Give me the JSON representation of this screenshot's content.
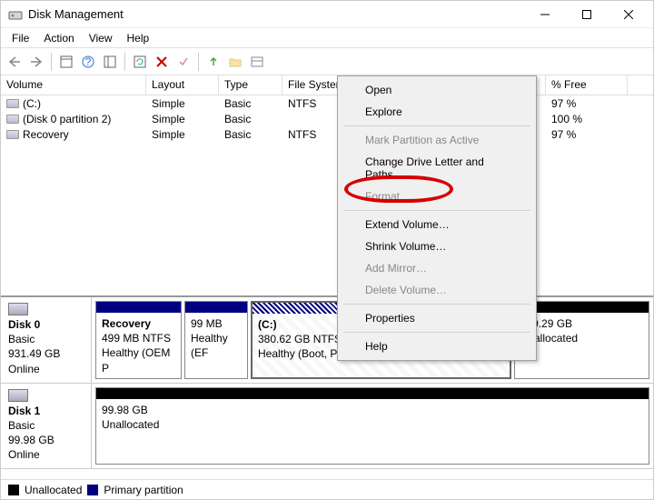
{
  "window": {
    "title": "Disk Management"
  },
  "menu": {
    "items": [
      "File",
      "Action",
      "View",
      "Help"
    ]
  },
  "columns": {
    "volume": "Volume",
    "layout": "Layout",
    "type": "Type",
    "fs": "File System",
    "free": "% Free"
  },
  "volumes": [
    {
      "name": "(C:)",
      "layout": "Simple",
      "type": "Basic",
      "fs": "NTFS",
      "free": "97 %"
    },
    {
      "name": "(Disk 0 partition 2)",
      "layout": "Simple",
      "type": "Basic",
      "fs": "",
      "free": "100 %"
    },
    {
      "name": "Recovery",
      "layout": "Simple",
      "type": "Basic",
      "fs": "NTFS",
      "free": "97 %"
    }
  ],
  "context": {
    "open": "Open",
    "explore": "Explore",
    "mark": "Mark Partition as Active",
    "letter": "Change Drive Letter and Paths…",
    "format": "Format…",
    "extend": "Extend Volume…",
    "shrink": "Shrink Volume…",
    "mirror": "Add Mirror…",
    "delete": "Delete Volume…",
    "properties": "Properties",
    "help": "Help"
  },
  "disks": {
    "d0": {
      "label": "Disk 0",
      "type": "Basic",
      "size": "931.49 GB",
      "status": "Online",
      "parts": [
        {
          "title": "Recovery",
          "line2": "499 MB NTFS",
          "line3": "Healthy (OEM P"
        },
        {
          "title": "",
          "line2": "99 MB",
          "line3": "Healthy (EF"
        },
        {
          "title": "(C:)",
          "line2": "380.62 GB NTFS",
          "line3": "Healthy (Boot, Page File, Crash Dump"
        },
        {
          "title": "",
          "line2": "550.29 GB",
          "line3": "Unallocated"
        }
      ]
    },
    "d1": {
      "label": "Disk 1",
      "type": "Basic",
      "size": "99.98 GB",
      "status": "Online",
      "parts": [
        {
          "title": "",
          "line2": "99.98 GB",
          "line3": "Unallocated"
        }
      ]
    }
  },
  "legend": {
    "unalloc": "Unallocated",
    "primary": "Primary partition"
  }
}
